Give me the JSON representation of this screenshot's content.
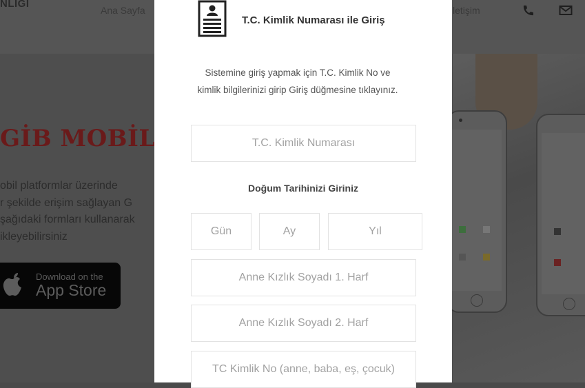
{
  "background": {
    "logo_text": "NLIGI",
    "nav_left": "Ana Sayfa",
    "nav_right": "letişim",
    "icons": [
      "phone-icon",
      "mail-icon"
    ],
    "hero_title": "GİB MOBİL HİZ",
    "hero_lines": [
      "obil platformlar üzerinde",
      "r şekilde erişim sağlayan G",
      "şağıdaki formları kullanarak",
      "ikleyebilirsiniz"
    ],
    "appstore": {
      "small": "Download on the",
      "big": "App Store"
    }
  },
  "modal": {
    "icon": "id-card-icon",
    "title": "T.C. Kimlik Numarası ile Giriş",
    "description": "Sistemine giriş yapmak için T.C. Kimlik No ve kimlik bilgilerinizi girip Giriş düğmesine tıklayınız.",
    "tc_placeholder": "T.C. Kimlik Numarası",
    "dob_label": "Doğum Tarihinizi Giriniz",
    "day_placeholder": "Gün",
    "month_placeholder": "Ay",
    "year_placeholder": "Yıl",
    "mother1_placeholder": "Anne Kızlık Soyadı 1. Harf",
    "mother2_placeholder": "Anne Kızlık Soyadı 2. Harf",
    "relative_placeholder": "TC Kimlik No (anne, baba, eş, çocuk)"
  },
  "colors": {
    "overlay_bg": "#4a4a4a",
    "modal_bg": "#ffffff",
    "field_border": "#e2e2e2",
    "hero_title": "#6a1a1a"
  }
}
